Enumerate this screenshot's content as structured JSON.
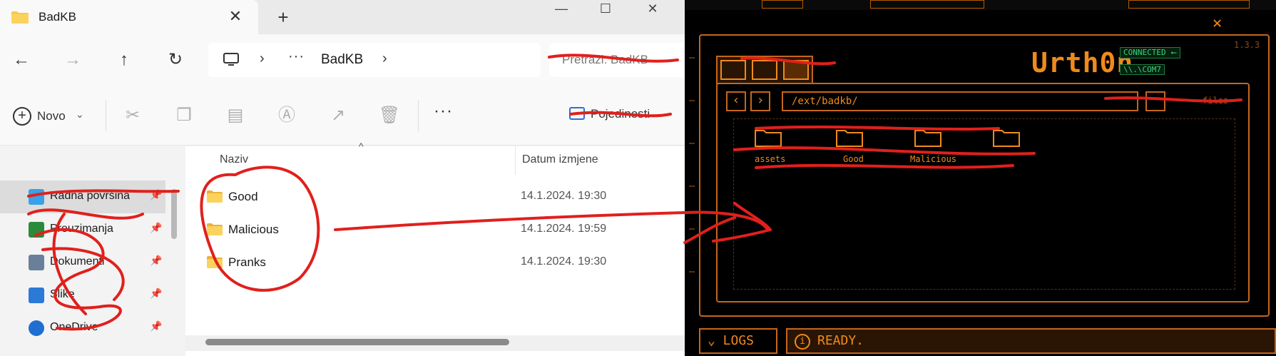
{
  "explorer": {
    "tab_title": "BadKB",
    "tab_close": "✕",
    "tab_new": "+",
    "win_min": "—",
    "win_max": "☐",
    "win_close": "✕",
    "nav_back": "←",
    "nav_forward": "→",
    "nav_up": "↑",
    "nav_refresh": "↻",
    "addr_sep": "›",
    "addr_more": "···",
    "addr_crumb": "BadKB",
    "search_placeholder": "Pretraži: BadKB",
    "cmd_new": "Novo",
    "cmd_new_caret": "⌄",
    "cmd_more": "···",
    "cmd_details": "Pojedinosti",
    "icon_cut": "✂",
    "icon_copy": "❐",
    "icon_paste": "▤",
    "icon_rename": "Ⓐ",
    "icon_share": "↗",
    "icon_delete": "🗑",
    "nav_items": [
      {
        "label": "Radna površina",
        "pin": "📌",
        "color": "#3aa0e8"
      },
      {
        "label": "Preuzimanja",
        "pin": "📌",
        "color": "#2a8a3a"
      },
      {
        "label": "Dokumenti",
        "pin": "📌",
        "color": "#6a7f9a"
      },
      {
        "label": "Slike",
        "pin": "📌",
        "color": "#2a7ad6"
      },
      {
        "label": "OneDrive",
        "pin": "📌",
        "color": "#1e6fd1"
      }
    ],
    "col_name": "Naziv",
    "col_date": "Datum izmjene",
    "sort_caret": "^",
    "files": [
      {
        "name": "Good",
        "date": "14.1.2024. 19:30"
      },
      {
        "name": "Malicious",
        "date": "14.1.2024. 19:59"
      },
      {
        "name": "Pranks",
        "date": "14.1.2024. 19:30"
      }
    ],
    "folder_color": "#f7c948"
  },
  "urth": {
    "brand": "Urth0n",
    "version": "1.3.3",
    "connected": "CONNECTED ⭠",
    "port": "\\\\.\\COM7",
    "close": "✕",
    "nav_prev": "‹",
    "nav_next": "›",
    "path": "/ext/badkb/",
    "filter": "files",
    "folders": [
      {
        "label": "assets"
      },
      {
        "label": "Good"
      },
      {
        "label": "Malicious"
      },
      {
        "label": ""
      }
    ],
    "logs": "⌄ LOGS",
    "status_icon": "i",
    "status": "READY.",
    "accent": "#f08a1c"
  }
}
